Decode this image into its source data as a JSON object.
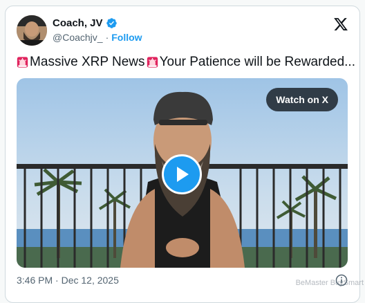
{
  "author": {
    "name": "Coach, JV",
    "handle": "@Coachjv_",
    "separator": "·",
    "follow_label": "Follow"
  },
  "tweet": {
    "text_part1": "Massive XRP News",
    "text_part2": " Your Patience will be Rewarded..."
  },
  "media": {
    "watch_label": "Watch on X"
  },
  "footer": {
    "timestamp": "3:46 PM · Dec 12, 2025"
  },
  "watermark": "BeMaster BuySmart",
  "colors": {
    "accent": "#1d9bf0",
    "siren_red": "#e0245e"
  },
  "icons": [
    "verified-badge-icon",
    "x-logo-icon",
    "siren-emoji-icon",
    "play-icon",
    "info-icon"
  ]
}
